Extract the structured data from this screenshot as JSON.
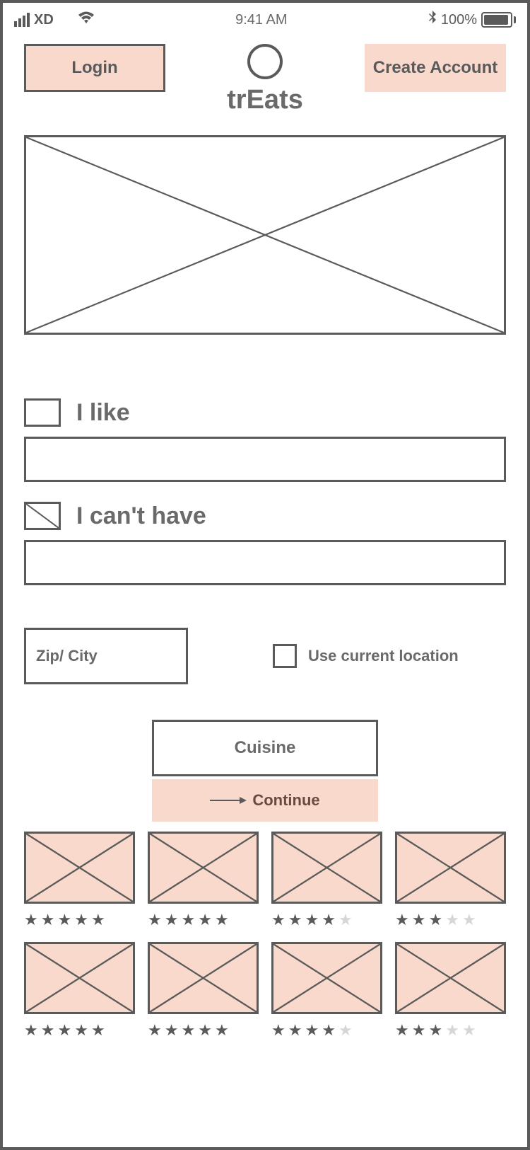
{
  "status": {
    "carrier": "XD",
    "time": "9:41 AM",
    "battery_pct": "100%"
  },
  "header": {
    "login": "Login",
    "create": "Create Account",
    "app_name": "trEats"
  },
  "fields": {
    "like_label": "I like",
    "cant_label": "I can't have",
    "zip_placeholder": "Zip/ City",
    "use_location": "Use current location"
  },
  "buttons": {
    "cuisine": "Cuisine",
    "continue": "Continue"
  },
  "grid": {
    "cards": [
      {
        "rating": 5
      },
      {
        "rating": 5
      },
      {
        "rating": 4.5
      },
      {
        "rating": 3
      },
      {
        "rating": 5
      },
      {
        "rating": 5
      },
      {
        "rating": 4
      },
      {
        "rating": 3
      }
    ]
  }
}
